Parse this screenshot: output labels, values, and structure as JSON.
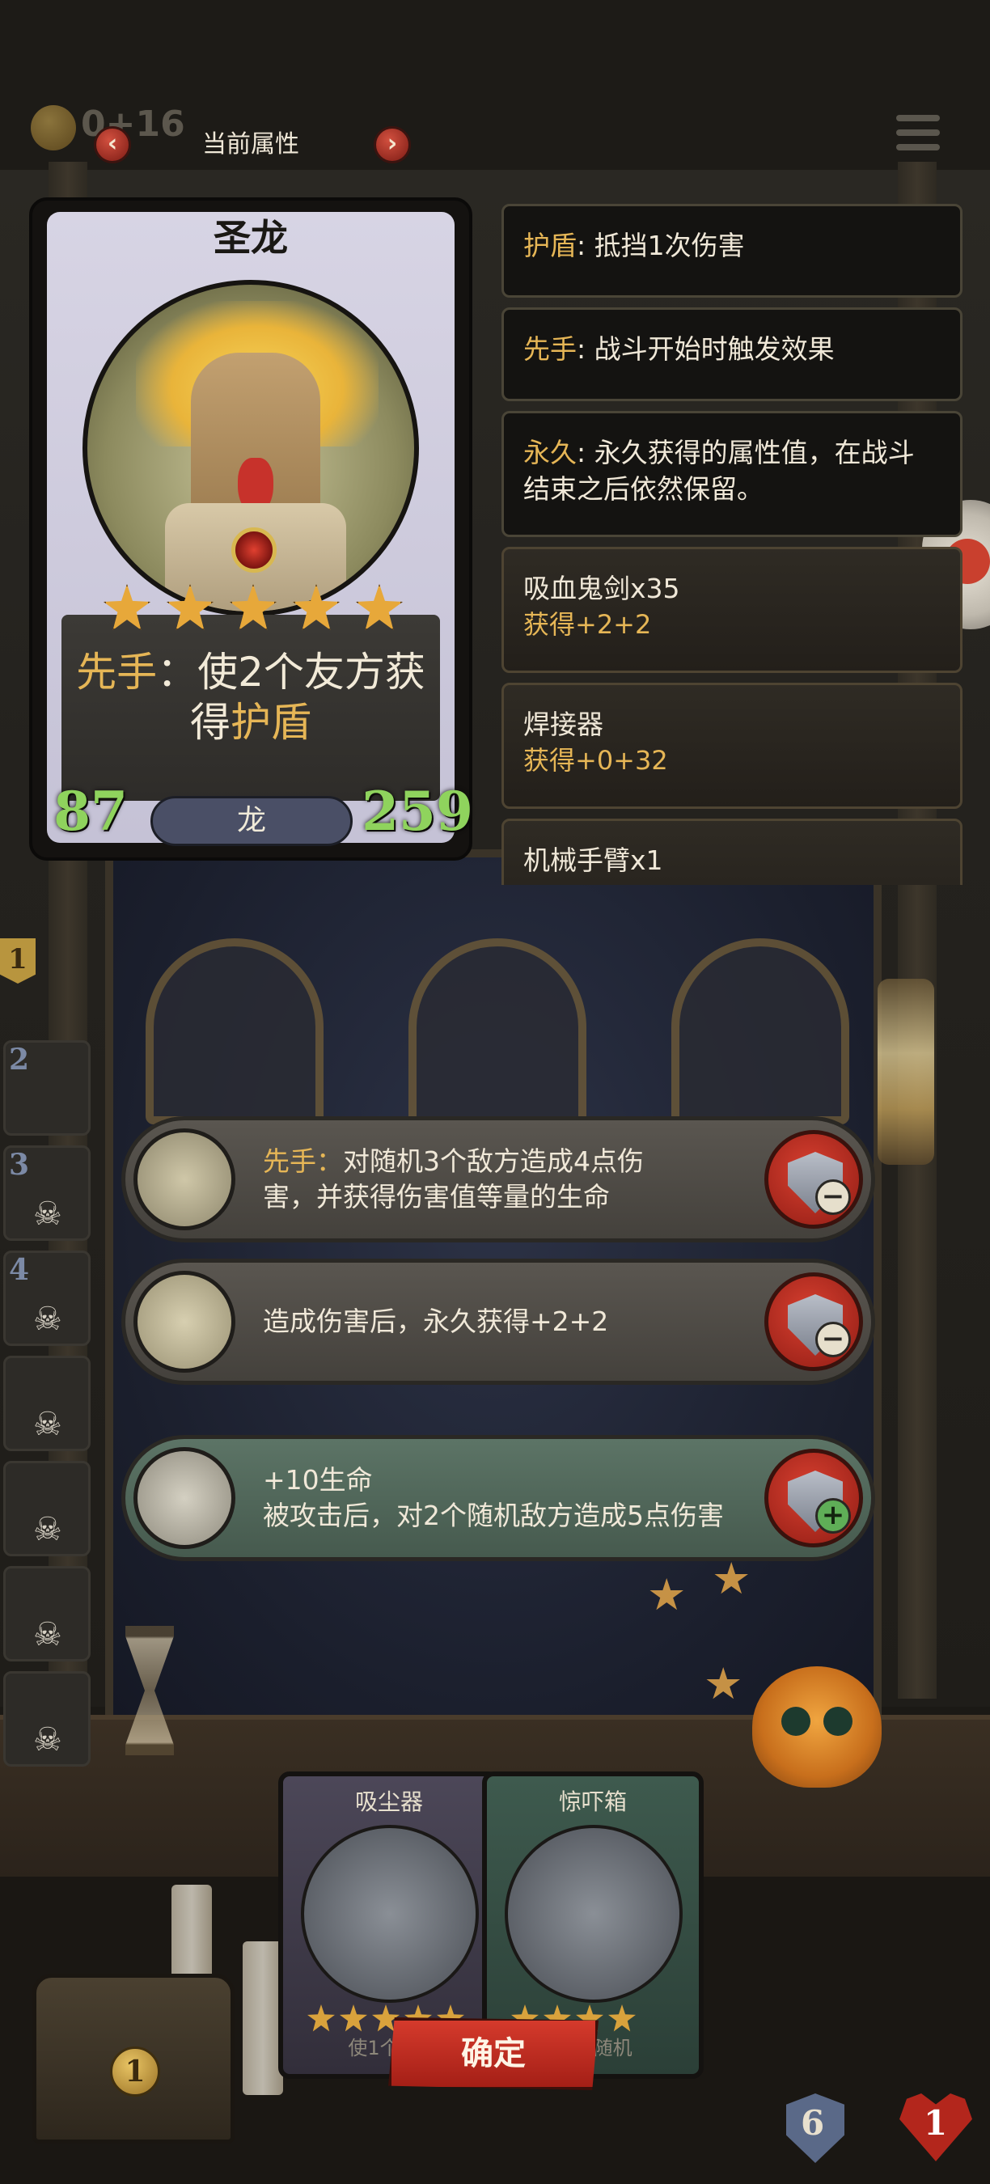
{
  "header": {
    "coins": "0+16",
    "title": "当前属性",
    "prev_icon": "chevron-left-icon",
    "next_icon": "chevron-right-icon",
    "menu_icon": "menu-icon"
  },
  "unit_card": {
    "name": "圣龙",
    "stars": 5,
    "ability_keyword": "先手",
    "ability_colon": "：",
    "ability_text_a": "使2个友方获",
    "ability_text_b": "得",
    "ability_keyword2": "护盾",
    "attack": "87",
    "health": "259",
    "tribe": "龙"
  },
  "info_panels": [
    {
      "keyword": "护盾",
      "text": ": 抵挡1次伤害"
    },
    {
      "keyword": "先手",
      "text": ": 战斗开始时触发效果"
    },
    {
      "keyword": "永久",
      "text": ": 永久获得的属性值，在战斗结束之后依然保留。"
    }
  ],
  "items": [
    {
      "name": "吸血鬼剑x35",
      "gain": "获得+2+2"
    },
    {
      "name": "焊接器",
      "gain": "获得+0+32"
    },
    {
      "name": "机械手臂x1",
      "gain": ""
    }
  ],
  "ability_rows": [
    {
      "keyword": "先手",
      "colon": "：",
      "line1": "对随机3个敌方造成4点伤",
      "line2": "害，并获得伤害值等量的生命",
      "action": "remove"
    },
    {
      "keyword": "",
      "colon": "",
      "line1": "造成伤害后，永久获得+2+2",
      "line2": "",
      "action": "remove"
    },
    {
      "keyword": "",
      "colon": "",
      "line1": "+10生命",
      "line2": "被攻击后，对2个随机敌方造成5点伤害",
      "action": "add"
    }
  ],
  "side_slots": [
    "1",
    "2",
    "3",
    "4"
  ],
  "bottom_cards": [
    {
      "name": "吸尘器",
      "desc": "使1个友方",
      "stars": 5
    },
    {
      "name": "惊吓箱",
      "desc": "2个随机",
      "stars": 4
    }
  ],
  "confirm_label": "确定",
  "hud": {
    "chest_coin": "1",
    "shield_value": "6",
    "heart_value": "1"
  },
  "colors": {
    "keyword": "#e6b656",
    "stat_green": "#8fd35d",
    "confirm_red": "#c8322a"
  }
}
